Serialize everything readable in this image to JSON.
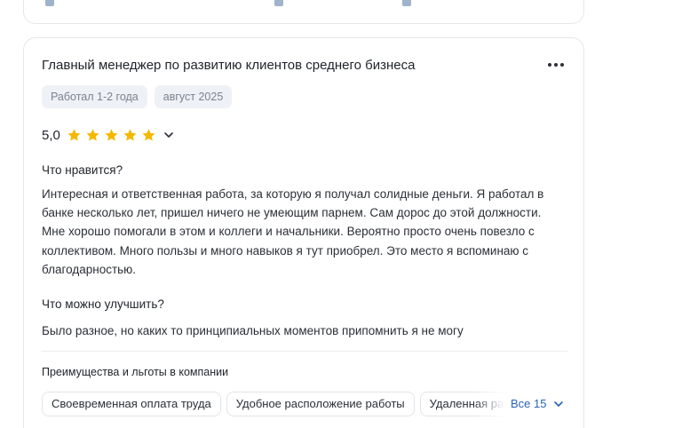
{
  "review": {
    "title": "Главный менеджер по развитию клиентов среднего бизнеса",
    "tags": [
      "Работал 1-2 года",
      "август 2025"
    ],
    "rating": "5,0",
    "stars": 5,
    "likes_heading": "Что нравится?",
    "likes_text": "Интересная и ответственная работа, за которую я получал солидные деньги. Я работал в\nбанке несколько лет, пришел ничего не умеющим парнем. Сам дорос до этой должности.\nМне хорошо помогали в этом и коллеги и начальники. Вероятно просто очень повезло с\nколлективом. Много пользы и много навыков я тут приобрел. Это место я вспоминаю с\nблагодарностью.",
    "improve_heading": "Что можно улучшить?",
    "improve_text": "Было разное, но каких то принципиальных моментов припомнить я не могу",
    "benefits_title": "Преимущества и льготы в компании",
    "benefits": [
      "Своевременная оплата труда",
      "Удобное расположение работы",
      "Удаленная работа"
    ],
    "all_benefits_label": "Все 15"
  },
  "colors": {
    "star": "#f5b800",
    "link": "#2a62b8",
    "tag_bg": "#eef1f5"
  },
  "icons": [
    "more-dots-icon",
    "star-icon",
    "chevron-down-icon"
  ]
}
